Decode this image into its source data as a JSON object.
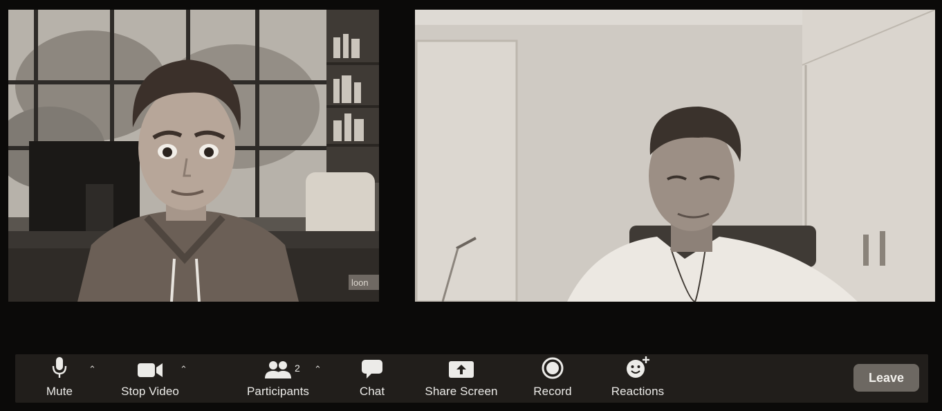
{
  "participants_view": {
    "left": {
      "video": "avatar"
    },
    "right": {
      "video": "camera"
    }
  },
  "toolbar": {
    "mute_label": "Mute",
    "stop_video_label": "Stop Video",
    "participants_label": "Participants",
    "participants_count": "2",
    "chat_label": "Chat",
    "share_screen_label": "Share Screen",
    "record_label": "Record",
    "reactions_label": "Reactions",
    "leave_label": "Leave"
  },
  "icons": {
    "mute": "microphone-icon",
    "video": "video-camera-icon",
    "participants": "people-icon",
    "chat": "chat-bubble-icon",
    "share": "share-arrow-icon",
    "record": "record-circle-icon",
    "reactions": "smiley-plus-icon",
    "caret": "chevron-up-icon"
  },
  "colors": {
    "background": "#0b0a09",
    "toolbar": "#211e1b",
    "leave_button": "#6d6862",
    "text": "#ecebe8"
  }
}
